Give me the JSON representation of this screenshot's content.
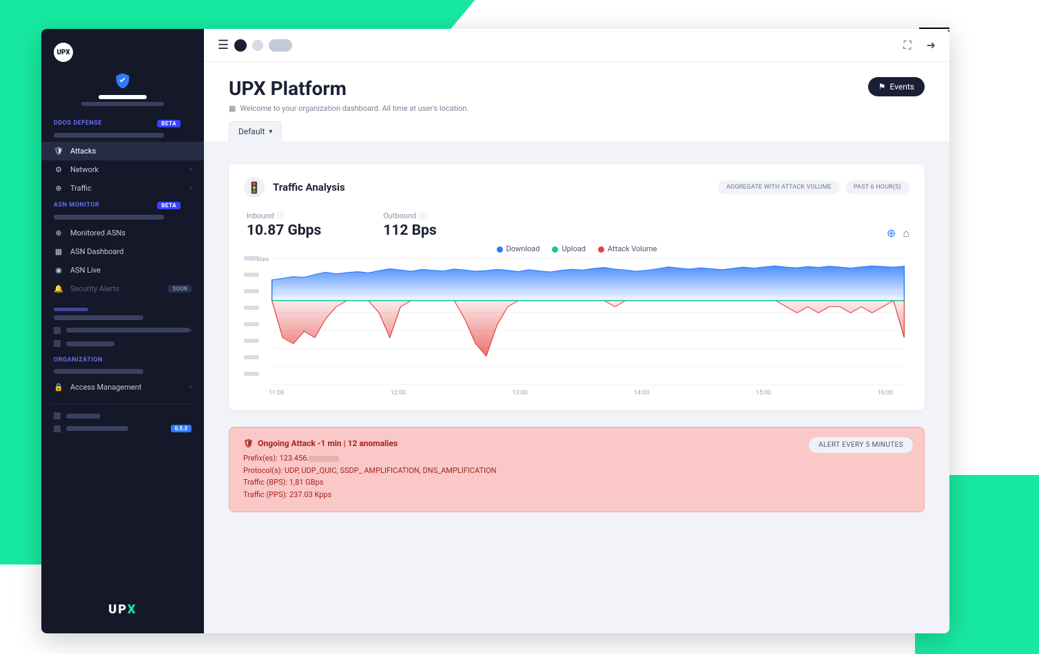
{
  "brand": {
    "short": "UPX",
    "logo_text": "UPX"
  },
  "sidebar": {
    "sections": {
      "ddos": {
        "title": "DDOS DEFENSE",
        "badge": "BETA",
        "items": [
          {
            "label": "Attacks",
            "icon": "shield",
            "active": true
          },
          {
            "label": "Network",
            "icon": "share",
            "chev": true
          },
          {
            "label": "Traffic",
            "icon": "globe",
            "chev": true
          }
        ]
      },
      "asn": {
        "title": "ASN MONITOR",
        "badge": "BETA",
        "items": [
          {
            "label": "Monitored ASNs",
            "icon": "search"
          },
          {
            "label": "ASN Dashboard",
            "icon": "grid"
          },
          {
            "label": "ASN Live",
            "icon": "eye"
          },
          {
            "label": "Security Alerts",
            "icon": "bell",
            "disabled": true,
            "badge": "SOON"
          }
        ]
      },
      "org": {
        "title": "ORGANIZATION",
        "items": [
          {
            "label": "Access Management",
            "icon": "lock",
            "chev": true
          }
        ]
      }
    },
    "version": "0.5.3"
  },
  "header": {
    "title": "UPX Platform",
    "welcome": "Welcome to your organization dashboard. All time at user's location.",
    "events_btn": "Events",
    "tab": "Default"
  },
  "traffic_card": {
    "title": "Traffic Analysis",
    "chip1": "AGGREGATE WITH ATTACK VOLUME",
    "chip2": "PAST 6 HOUR(S)",
    "inbound_label": "Inbound",
    "inbound_value": "10.87 Gbps",
    "outbound_label": "Outbound",
    "outbound_value": "112 Bps",
    "legend": {
      "download": "Download",
      "upload": "Upload",
      "attack": "Attack Volume"
    },
    "ylabel_top": "14.0 Gbps"
  },
  "chart_data": {
    "type": "area",
    "xlabel": "",
    "ylabel": "",
    "x_ticks": [
      "11:00",
      "12:00",
      "13:00",
      "14:00",
      "15:00",
      "16:00"
    ],
    "ylim": [
      -14,
      14
    ],
    "series": [
      {
        "name": "Download",
        "color": "#2f7bff",
        "x": [
          0,
          1,
          2,
          3,
          4,
          5,
          6,
          7,
          8,
          9,
          10,
          11,
          12,
          13,
          14,
          15,
          16,
          17,
          18,
          19,
          20,
          21,
          22,
          23,
          24,
          25,
          26,
          27,
          28,
          29,
          30,
          31,
          32,
          33,
          34,
          35,
          36,
          37,
          38,
          39,
          40,
          41,
          42,
          43,
          44,
          45,
          46,
          47,
          48,
          49,
          50,
          51,
          52,
          53,
          54,
          55,
          56,
          57,
          58,
          59
        ],
        "values": [
          6.5,
          7,
          7.5,
          7.3,
          8.2,
          8.9,
          8.4,
          8.8,
          9.1,
          8.7,
          9.4,
          10.0,
          9.6,
          9.2,
          9.8,
          9.5,
          9.3,
          9.9,
          9.6,
          9.2,
          9.4,
          9.8,
          9.5,
          9.1,
          9.7,
          9.3,
          9.0,
          9.5,
          9.8,
          9.6,
          10.1,
          10.4,
          9.9,
          9.6,
          9.2,
          9.5,
          10.0,
          10.6,
          10.2,
          9.9,
          10.3,
          10.0,
          9.7,
          10.1,
          10.5,
          10.2,
          10.6,
          10.9,
          10.5,
          10.3,
          10.7,
          10.4,
          10.8,
          10.5,
          10.2,
          10.6,
          10.9,
          10.7,
          10.5,
          10.8
        ]
      },
      {
        "name": "Upload",
        "color": "#13c98f",
        "x": [
          0,
          59
        ],
        "values": [
          0,
          0
        ]
      },
      {
        "name": "Attack Volume",
        "color": "#e4423f",
        "x": [
          0,
          1,
          2,
          3,
          4,
          5,
          6,
          7,
          8,
          9,
          10,
          11,
          12,
          13,
          14,
          15,
          16,
          17,
          18,
          19,
          20,
          21,
          22,
          23,
          24,
          25,
          26,
          27,
          28,
          29,
          30,
          31,
          32,
          33,
          34,
          35,
          36,
          37,
          38,
          39,
          40,
          41,
          42,
          43,
          44,
          45,
          46,
          47,
          48,
          49,
          50,
          51,
          52,
          53,
          54,
          55,
          56,
          57,
          58,
          59
        ],
        "values": [
          0,
          -6,
          -7,
          -5,
          -6,
          -3,
          -1,
          0,
          0,
          0,
          -2,
          -6,
          -1,
          0,
          0,
          0,
          0,
          0,
          -3,
          -7,
          -9,
          -4,
          -1,
          0,
          0,
          0,
          0,
          0,
          0,
          0,
          0,
          0,
          -1,
          0,
          0,
          0,
          0,
          0,
          0,
          0,
          0,
          0,
          0,
          0,
          0,
          0,
          0,
          0,
          -1,
          -2,
          -1,
          -2,
          -1,
          -1,
          -2,
          -1,
          -2,
          -1,
          0,
          -6
        ]
      }
    ]
  },
  "alert": {
    "title": "Ongoing Attack -1 min | 12 anomalies",
    "prefixes_label": "Prefix(es):",
    "prefixes_value": "123.456.",
    "protocols": "Protocol(s): UDP, UDP_QUIC, SSDP_ AMPLIFICATION, DNS_AMPLIFICATION",
    "bps": "Traffic (BPS): 1,81 GBps",
    "pps": "Traffic (PPS): 237.03 Kpps",
    "chip": "ALERT EVERY 5 MINUTES"
  }
}
